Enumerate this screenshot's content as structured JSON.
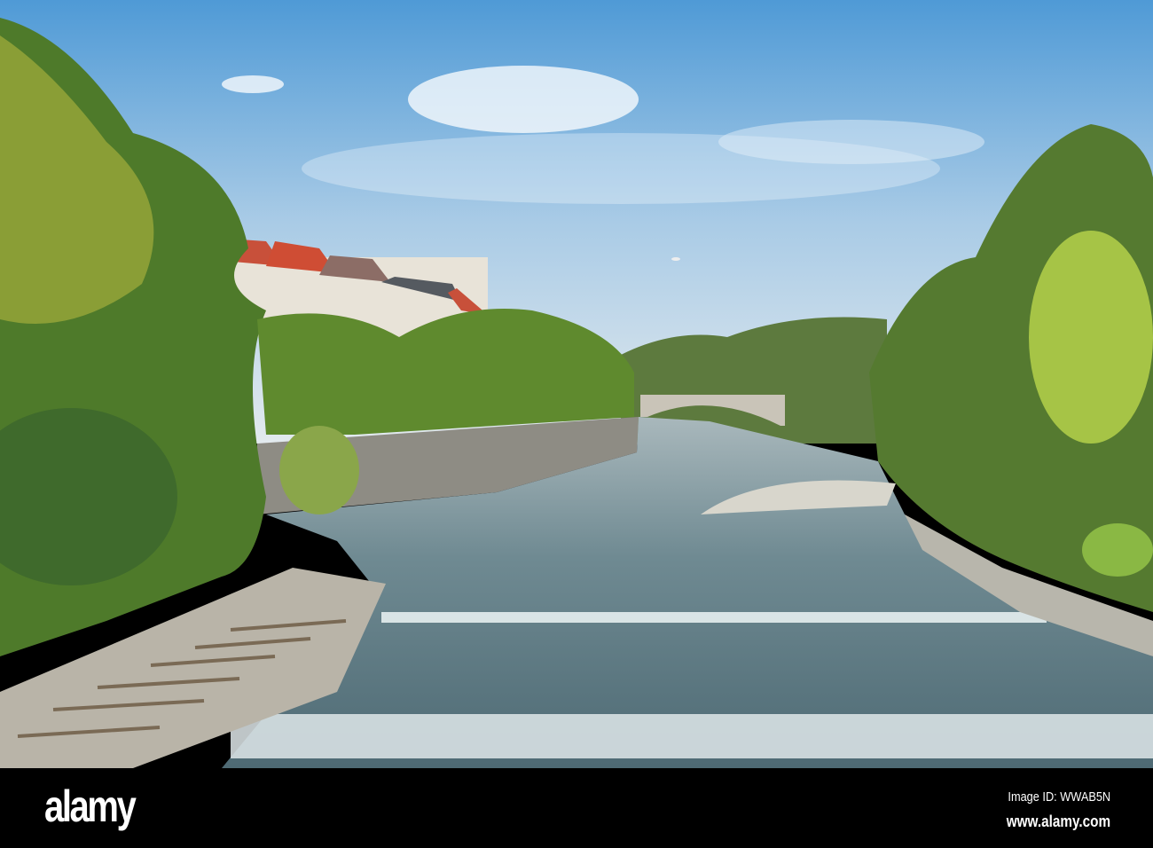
{
  "watermark": {
    "logo": "alamy",
    "image_id": "Image ID: WWAB5N",
    "website": "www.alamy.com"
  },
  "colors": {
    "sky_top": "#4f9ad6",
    "sky_horizon": "#dfe8ee",
    "water": "#6f8a92",
    "foliage": "#5f8a2e",
    "roof": "#c8503a",
    "bar": "#000000"
  }
}
